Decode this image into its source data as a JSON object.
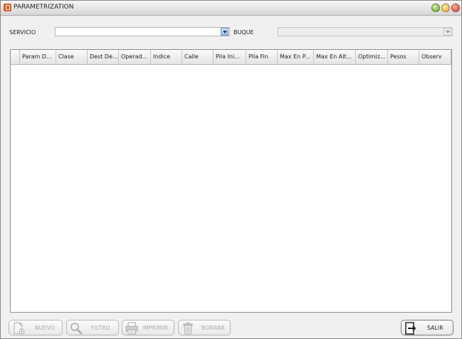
{
  "window": {
    "title": "PARAMETRIZATION"
  },
  "filters": {
    "servicio_label": "SERVICIO",
    "servicio_value": "",
    "buque_label": "BUQUE",
    "buque_value": ""
  },
  "grid": {
    "columns": [
      "Param D...",
      "Clase",
      "Dest De...",
      "Operad...",
      "Indice",
      "Calle",
      "Pila Ini...",
      "Pila Fin",
      "Max En P...",
      "Max En Alt...",
      "Optimiz...",
      "Pesos",
      "Observ"
    ],
    "rows": []
  },
  "footer": {
    "nuevo": "NUEVO",
    "filtro": "FILTRO",
    "imprimir": "IMPRIMIR",
    "borrar": "BORRAR",
    "salir": "SALIR"
  }
}
